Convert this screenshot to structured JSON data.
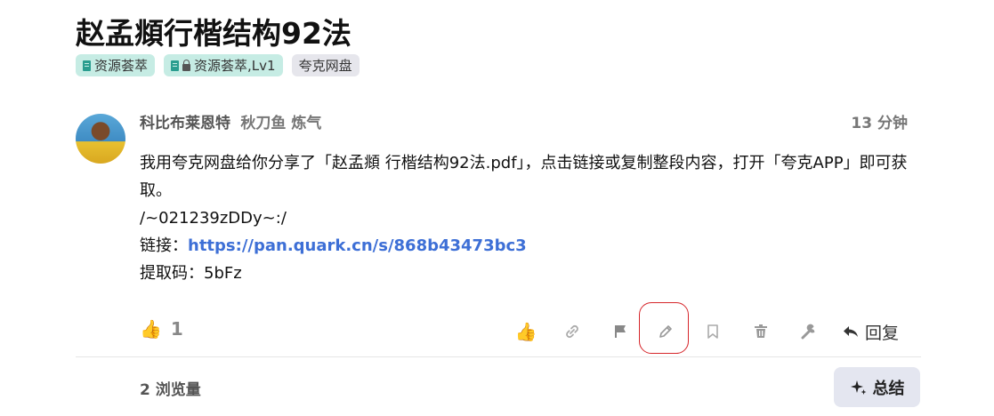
{
  "topic": {
    "title": "赵孟頫行楷结构92法",
    "tags": [
      {
        "label": "资源荟萃",
        "icon": "book-icon"
      },
      {
        "label": "资源荟萃,Lv1",
        "icon": "book-lock-icon"
      },
      {
        "label": "夸克网盘"
      }
    ]
  },
  "post": {
    "author_name": "科比布莱恩特",
    "author_title": "秋刀鱼 炼气",
    "timestamp": "13 分钟",
    "body": {
      "line1": "我用夸克网盘给你分享了「赵孟頫 行楷结构92法.pdf」，点击链接或复制整段内容，打开「夸克APP」即可获取。",
      "line2": "/~021239zDDy~:/",
      "link_prefix": "链接：",
      "link_url": "https://pan.quark.cn/s/868b43473bc3",
      "code_line": "提取码：5bFz"
    },
    "like_count": "1",
    "actions": [
      "like-icon",
      "link-icon",
      "flag-icon",
      "pencil-icon",
      "bookmark-icon",
      "trash-icon",
      "wrench-icon",
      "reply-icon"
    ],
    "reply_label": "回复"
  },
  "footer": {
    "views": "2 浏览量",
    "summary_label": "总结"
  },
  "colors": {
    "link": "#3d6fd6",
    "highlight_ring": "#d6252a",
    "tag_green": "#c6ece4",
    "tag_gray": "#e6e6ec",
    "like": "#f5a623"
  }
}
